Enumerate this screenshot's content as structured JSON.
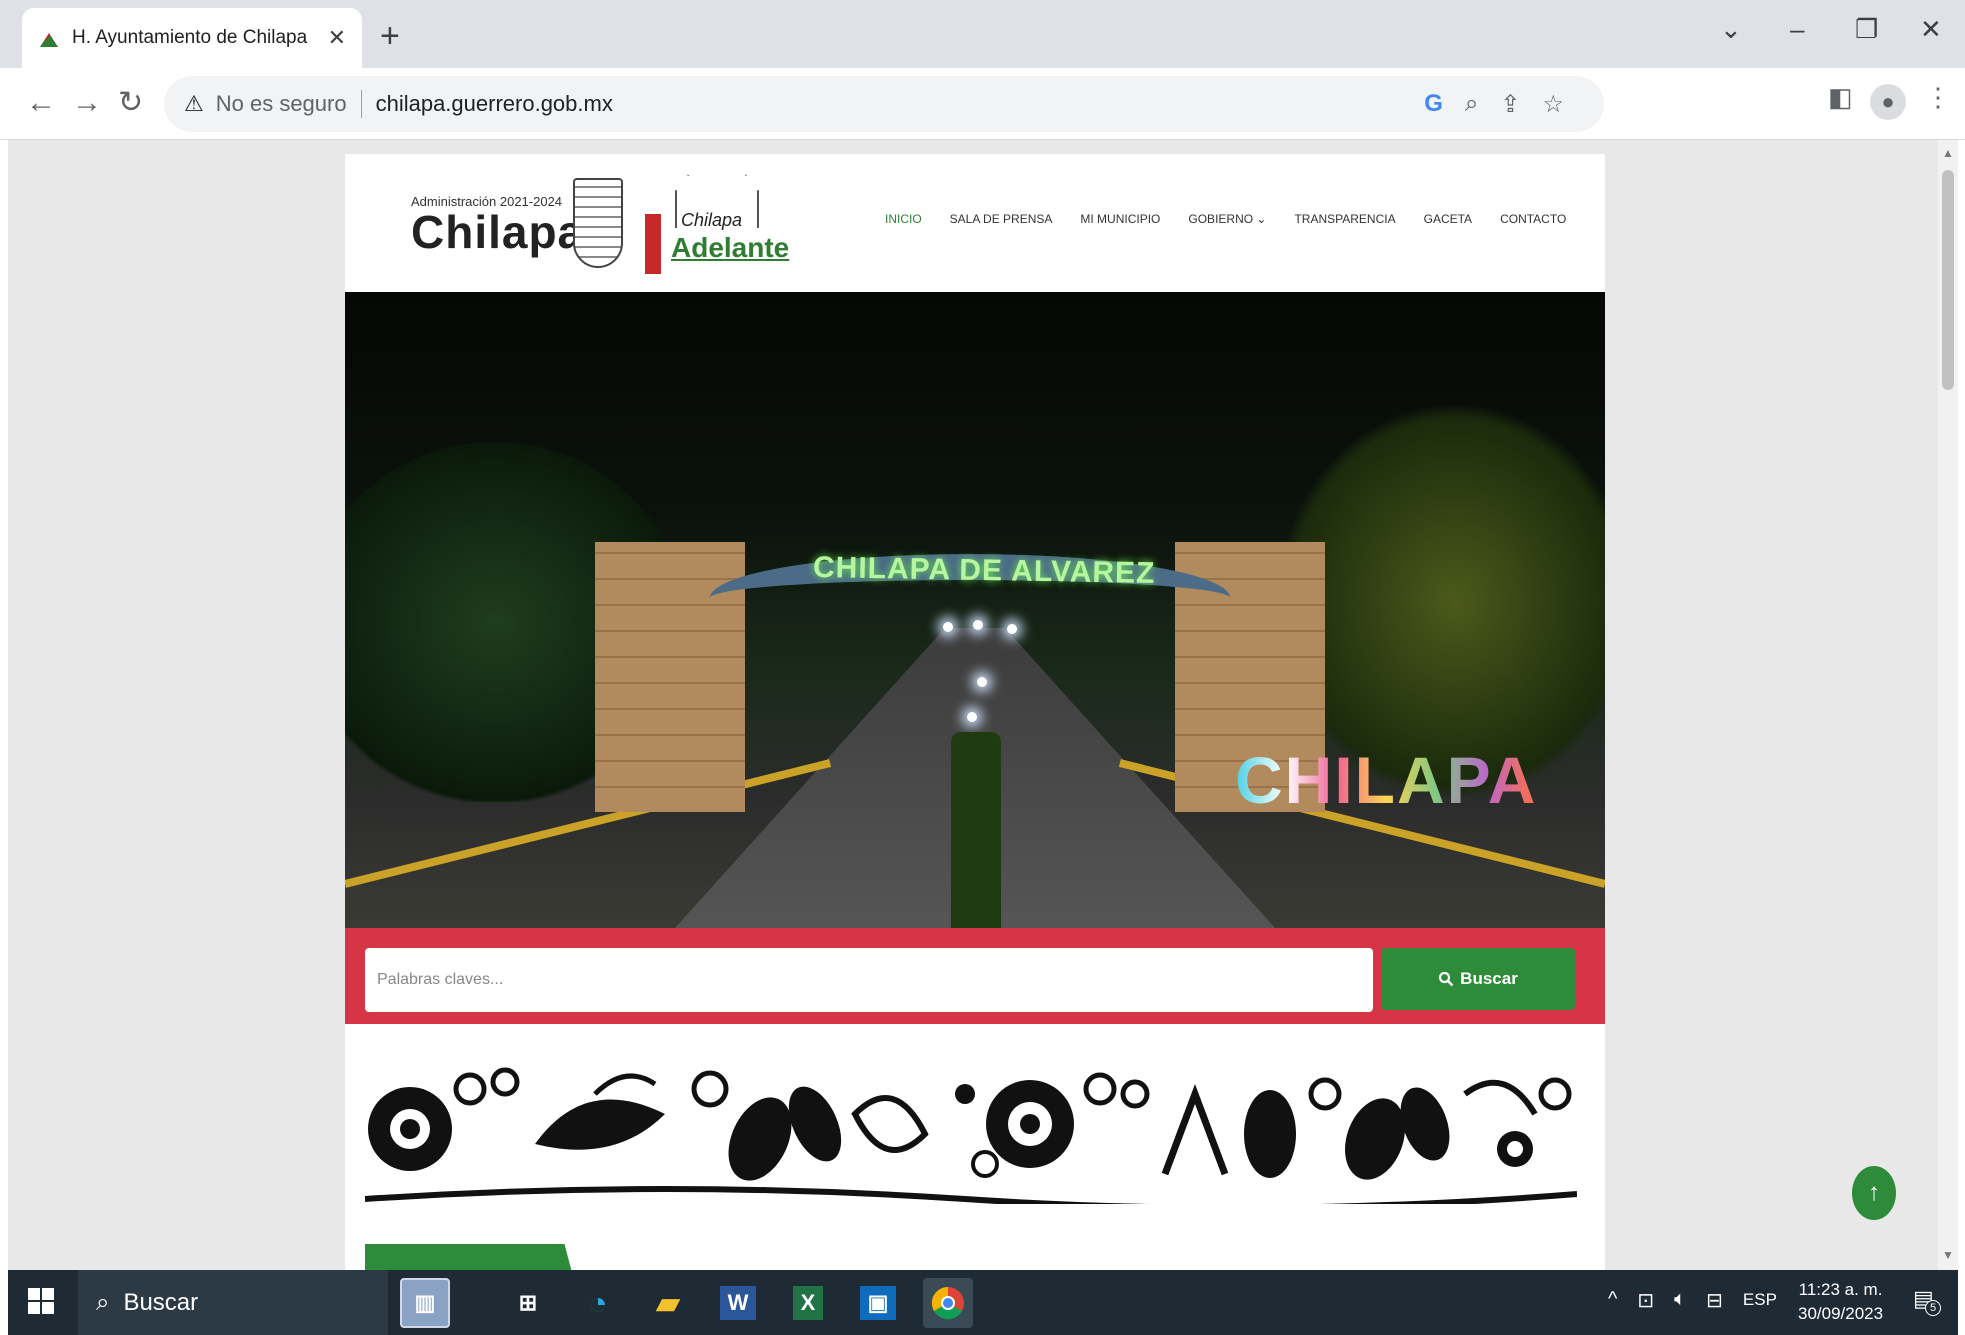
{
  "browser": {
    "tab_title": "H. Ayuntamiento de Chilapa de",
    "tab_close": "✕",
    "new_tab": "+",
    "security_icon": "⚠",
    "security_label": "No es seguro",
    "url": "chilapa.guerrero.gob.mx"
  },
  "site": {
    "admin_line": "Administración 2021-2024",
    "brand": "Chilapa",
    "adelante_top": "Chilapa",
    "adelante_bottom": "Adelante",
    "nav": [
      {
        "label": "INICIO"
      },
      {
        "label": "SALA DE PRENSA"
      },
      {
        "label": "MI MUNICIPIO"
      },
      {
        "label": "GOBIERNO ⌄"
      },
      {
        "label": "TRANSPARENCIA"
      },
      {
        "label": "GACETA"
      },
      {
        "label": "CONTACTO"
      }
    ],
    "hero": {
      "arch_text": "CHILAPA DE ALVAREZ",
      "sign_text": "CHILAPA"
    },
    "search": {
      "placeholder": "Palabras claves...",
      "button_label": "Buscar"
    }
  },
  "taskbar": {
    "search_label": "Buscar",
    "language": "ESP",
    "time": "11:23 a. m.",
    "date": "30/09/2023",
    "notification_count": "5"
  },
  "colors": {
    "brand_green": "#2e8b3a",
    "search_band_red": "#d63447",
    "taskbar": "#1e2b35"
  }
}
